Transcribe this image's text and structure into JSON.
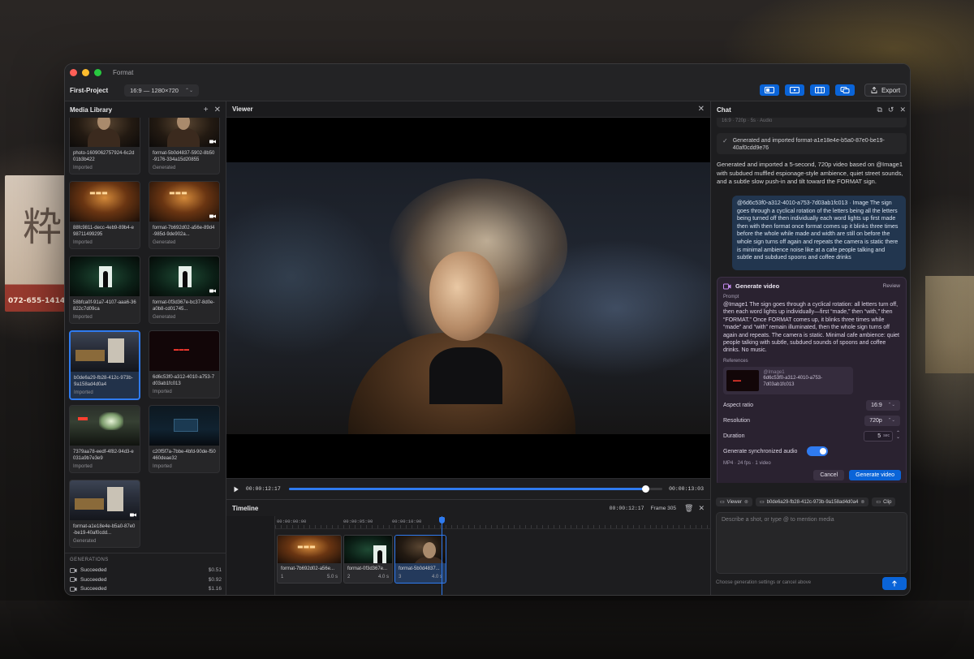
{
  "window": {
    "app_title": "Format"
  },
  "toolbar": {
    "project_name": "First-Project",
    "aspect_select": "16:9 — 1280×720",
    "export_label": "Export",
    "layout_buttons": [
      "layout-icon-1",
      "layout-icon-2",
      "layout-icon-3",
      "layout-icon-4"
    ]
  },
  "media_library": {
    "title": "Media Library",
    "items": [
      {
        "name": "photo-1609062757924-6c2d01b3b422",
        "status": "Imported",
        "thumb": "woman",
        "video": false
      },
      {
        "name": "format-5b0d4837-5902-8b50-9176-334a15d20855",
        "status": "Generated",
        "thumb": "woman",
        "video": true
      },
      {
        "name": "88fc9811-decc-4eb9-89b4-e98711499295",
        "status": "Imported",
        "thumb": "neon",
        "video": false
      },
      {
        "name": "format-7b692d02-a56e-89d4-985d-9de902a...",
        "status": "Generated",
        "thumb": "neon",
        "video": true
      },
      {
        "name": "58bfca0f-91a7-4107-aaa6-36822c7d09ca",
        "status": "Imported",
        "thumb": "green",
        "video": false
      },
      {
        "name": "format-0f3d367e-bc37-8d0e-a0b8-cd01745...",
        "status": "Generated",
        "thumb": "green",
        "video": true
      },
      {
        "name": "b0de6a29-fb28-412c-973b-9a158ad4d0a4",
        "status": "Imported",
        "thumb": "street",
        "video": false
      },
      {
        "name": "6d6c53f0-a312-4010-a753-7d03ab1fc013",
        "status": "Imported",
        "thumb": "redsign",
        "video": false
      },
      {
        "name": "7379aa78-eedf-4f82-94d3-e031a9b7e3e9",
        "status": "Imported",
        "thumb": "station",
        "video": false
      },
      {
        "name": "c20f5f7a-7bbe-4bfd-90de-f50460deae32",
        "status": "Imported",
        "thumb": "night",
        "video": false
      },
      {
        "name": "format-a1e18e4e-b5a0-87e0-be19-40af0cdd...",
        "status": "Generated",
        "thumb": "street",
        "video": true
      }
    ],
    "generations_title": "GENERATIONS",
    "generations": [
      {
        "status": "Succeeded",
        "cost": "$0.51"
      },
      {
        "status": "Succeeded",
        "cost": "$0.92"
      },
      {
        "status": "Succeeded",
        "cost": "$1.16"
      }
    ]
  },
  "viewer": {
    "title": "Viewer",
    "current_time": "00:00:12:17",
    "end_time": "00:00:13:03",
    "progress": 0.955
  },
  "timeline": {
    "title": "Timeline",
    "current_time": "00:00:12:17",
    "frame": "Frame 305",
    "ruler_labels": [
      "00:00:00:00",
      "00:00:05:00",
      "00:00:10:00"
    ],
    "clips": [
      {
        "name": "format-7b692d02-a56e...",
        "index": "1",
        "duration": "5.0 s",
        "thumb": "neon",
        "active": false
      },
      {
        "name": "format-0f3d367e...",
        "index": "2",
        "duration": "4.0 s",
        "thumb": "green",
        "active": false
      },
      {
        "name": "format-5b0d4837...",
        "index": "3",
        "duration": "4.0 s",
        "thumb": "woman",
        "active": true
      }
    ]
  },
  "chat": {
    "title": "Chat",
    "prev_meta": "16:9 · 720p · 5s · Audio",
    "status_message": "Generated and imported format-a1e18e4e-b5a0-87e0-be19-40af0cdd9e76",
    "assistant_message": "Generated and imported a 5-second, 720p video based on @Image1 with subdued muffled espionage-style ambience, quiet street sounds, and a subtle slow push-in and tilt toward the FORMAT sign.",
    "user_message": "@6d6c53f0-a312-4010-a753-7d03ab1fc013 · Image The sign goes through a cyclical rotation of the letters being all the letters being turned off then individually each word lights up first made then with then format once format comes up it blinks three times before the whole while made and width are still on before the whole sign turns off again and repeats the camera is static there is minimal ambience noise like at a cafe people talking and subtle and subdued spoons and coffee drinks",
    "gen_card": {
      "title": "Generate video",
      "review_label": "Review",
      "prompt_label": "Prompt",
      "prompt": "@Image1 The sign goes through a cyclical rotation: all letters turn off, then each word lights up individually—first “made,” then “with,” then “FORMAT.” Once FORMAT comes up, it blinks three times while “made” and “with” remain illuminated, then the whole sign turns off again and repeats. The camera is static. Minimal cafe ambience: quiet people talking with subtle, subdued sounds of spoons and coffee drinks. No music.",
      "references_label": "References",
      "reference_tag": "@Image1",
      "reference_name": "6d6c53f0-a312-4010-a753-7d03ab1fc013",
      "aspect_label": "Aspect ratio",
      "aspect_value": "16:9",
      "resolution_label": "Resolution",
      "resolution_value": "720p",
      "duration_label": "Duration",
      "duration_value": "5",
      "duration_unit": "sec",
      "audio_label": "Generate synchronized audio",
      "audio_on": true,
      "output_meta": "MP4 · 24 fps · 1 video",
      "cancel_label": "Cancel",
      "generate_label": "Generate video"
    },
    "chips": [
      {
        "label": "Viewer"
      },
      {
        "label": "b0de6a29-fb28-412c-973b-9a158ad4d0a4"
      },
      {
        "label": "Clip"
      }
    ],
    "input_placeholder": "Describe a shot, or type @ to mention media",
    "footer_hint": "Choose generation settings or cancel above"
  },
  "colors": {
    "accent": "#0a64d8",
    "progress": "#2f7bf0",
    "window_bg": "#1c1c1e"
  }
}
